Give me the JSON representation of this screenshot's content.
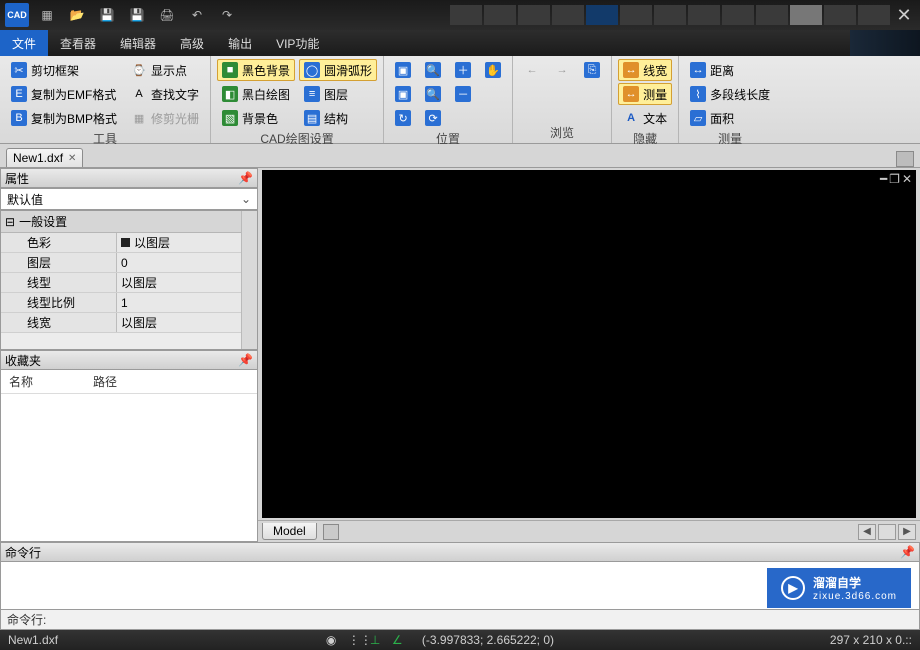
{
  "titlebar": {
    "app_badge": "CAD"
  },
  "menus": {
    "items": [
      "文件",
      "查看器",
      "编辑器",
      "高级",
      "输出",
      "VIP功能"
    ],
    "active_index": 0
  },
  "ribbon": {
    "group_tools": {
      "title": "工具",
      "items": [
        "剪切框架",
        "复制为EMF格式",
        "复制为BMP格式",
        "显示点",
        "查找文字",
        "修剪光栅"
      ]
    },
    "group_cad": {
      "title": "CAD绘图设置",
      "items": [
        "黑色背景",
        "黑白绘图",
        "背景色",
        "圆滑弧形",
        "图层",
        "结构"
      ]
    },
    "group_position": {
      "title": "位置"
    },
    "group_browse": {
      "title": "浏览"
    },
    "group_hide": {
      "title": "隐藏",
      "items": [
        "线宽",
        "测量",
        "文本"
      ]
    },
    "group_measure": {
      "title": "测量",
      "items": [
        "距离",
        "多段线长度",
        "面积"
      ]
    }
  },
  "filetabs": {
    "tabs": [
      "New1.dxf"
    ]
  },
  "panels": {
    "properties": {
      "title": "属性",
      "dropdown": "默认值",
      "section": "一般设置",
      "rows": [
        {
          "k": "色彩",
          "v": "以图层",
          "swatch": true
        },
        {
          "k": "图层",
          "v": "0"
        },
        {
          "k": "线型",
          "v": "以图层"
        },
        {
          "k": "线型比例",
          "v": "1"
        },
        {
          "k": "线宽",
          "v": "以图层"
        }
      ]
    },
    "favorites": {
      "title": "收藏夹",
      "col_name": "名称",
      "col_path": "路径"
    }
  },
  "model_tab": "Model",
  "command": {
    "panel_title": "命令行",
    "prompt": "命令行:"
  },
  "status": {
    "file": "New1.dxf",
    "coords": "(-3.997833; 2.665222; 0)",
    "dims": "297 x 210 x 0.::"
  },
  "watermark": {
    "brand": "溜溜自学",
    "url": "zixue.3d66.com"
  }
}
